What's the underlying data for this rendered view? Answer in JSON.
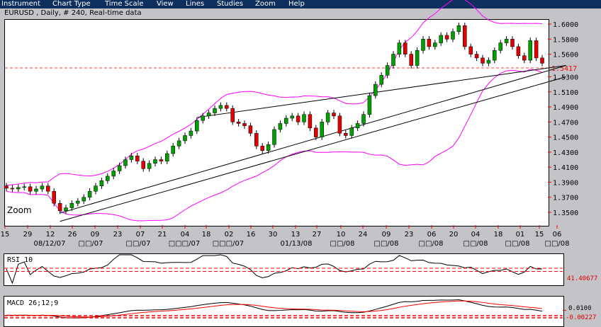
{
  "menu": [
    "Instrument",
    "Chart Type",
    "Time Scale",
    "View",
    "Lines",
    "Studies",
    "Zoom",
    "Help"
  ],
  "header": {
    "title": "EURUSD , Daily, # 240, Real-time data"
  },
  "main_chart": {
    "zoom_label": "Zoom"
  },
  "colors": {
    "up": "#00a000",
    "down": "#e00000",
    "bands": "#ff00ff",
    "marker": "#ff0000",
    "menu_bg": "#0c2f5e"
  },
  "chart_data": {
    "type": "candlestick",
    "symbol": "EURUSD",
    "timeframe": "Daily",
    "ylim": [
      1.35,
      1.6
    ],
    "y_ticks": [
      "1.6000",
      "1.5800",
      "1.5600",
      "1.5300",
      "1.5100",
      "1.4900",
      "1.4700",
      "1.4500",
      "1.4300",
      "1.4100",
      "1.3900",
      "1.3700",
      "1.3500"
    ],
    "y_tick_values": [
      1.6,
      1.58,
      1.56,
      1.53,
      1.51,
      1.49,
      1.47,
      1.45,
      1.43,
      1.41,
      1.39,
      1.37,
      1.35
    ],
    "current_price": 1.5417,
    "current_price_label": "1.5417",
    "x_day_ticks": [
      "15",
      "29",
      "12",
      "26",
      "09",
      "23",
      "07",
      "21",
      "04",
      "18",
      "02",
      "16",
      "30",
      "13",
      "27",
      "10",
      "24",
      "09",
      "23",
      "06",
      "20",
      "04",
      "18",
      "01",
      "15",
      "06"
    ],
    "x_month_labels": [
      "08/12/07",
      "□□/07",
      "□□/07",
      "□□□/07",
      "□□□/07",
      "01/13/08",
      "□□/08",
      "□□/08",
      "□□/08",
      "□□/08",
      "□□/08",
      "□□/08"
    ],
    "closes": [
      1.382,
      1.381,
      1.383,
      1.384,
      1.378,
      1.381,
      1.385,
      1.378,
      1.362,
      1.352,
      1.356,
      1.362,
      1.365,
      1.37,
      1.378,
      1.385,
      1.392,
      1.398,
      1.405,
      1.412,
      1.42,
      1.425,
      1.418,
      1.408,
      1.415,
      1.42,
      1.418,
      1.428,
      1.438,
      1.445,
      1.452,
      1.458,
      1.472,
      1.478,
      1.482,
      1.488,
      1.492,
      1.488,
      1.47,
      1.468,
      1.465,
      1.455,
      1.438,
      1.432,
      1.44,
      1.46,
      1.468,
      1.475,
      1.478,
      1.47,
      1.48,
      1.462,
      1.45,
      1.47,
      1.482,
      1.478,
      1.455,
      1.452,
      1.462,
      1.468,
      1.48,
      1.505,
      1.52,
      1.532,
      1.545,
      1.56,
      1.575,
      1.56,
      1.545,
      1.565,
      1.58,
      1.57,
      1.575,
      1.585,
      1.58,
      1.59,
      1.598,
      1.57,
      1.56,
      1.555,
      1.548,
      1.552,
      1.565,
      1.575,
      1.58,
      1.57,
      1.558,
      1.552,
      1.578,
      1.555,
      1.548
    ],
    "bollinger": {
      "period": 20,
      "stddev": 2
    },
    "trendlines": [
      {
        "from": [
          9,
          1.349
        ],
        "to": [
          94,
          1.545
        ]
      },
      {
        "from": [
          9,
          1.338
        ],
        "to": [
          94,
          1.53
        ]
      },
      {
        "from": [
          32,
          1.476
        ],
        "to": [
          94,
          1.545
        ]
      }
    ],
    "rsi": {
      "title": "RSI 10",
      "period": 10,
      "value_label": "41.40677",
      "levels": [
        50,
        41.4
      ]
    },
    "macd": {
      "title": "MACD 26;12;9",
      "tick_label": "0.0100",
      "value_label": "-0.00227",
      "tick_value": 0.01,
      "value": -0.00227
    }
  }
}
